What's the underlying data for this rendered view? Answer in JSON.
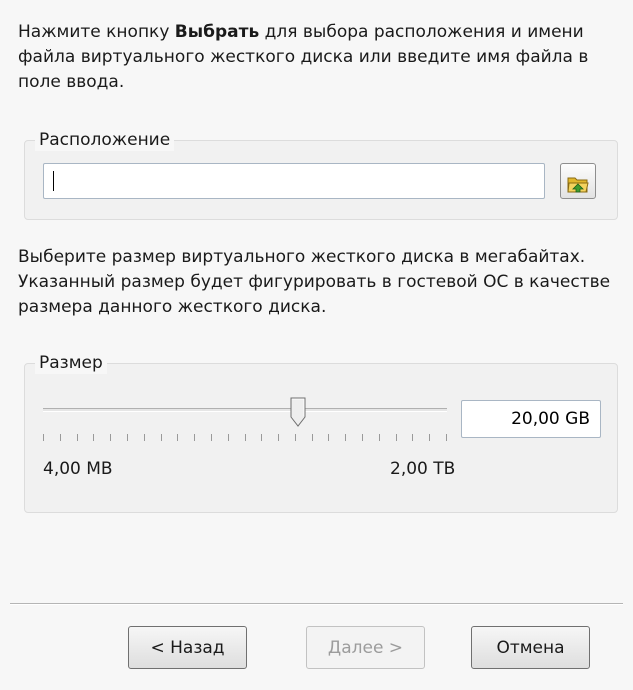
{
  "intro": {
    "text_before": "Нажмите кнопку ",
    "bold_word": "Выбрать",
    "text_after": " для выбора расположения и имени файла виртуального жесткого диска или введите имя файла в поле ввода."
  },
  "location": {
    "title": "Расположение",
    "value": "",
    "browse_icon": "folder-open-icon"
  },
  "size_description": "Выберите размер виртуального жесткого диска в мегабайтах. Указанный размер будет фигурировать в гостевой ОС в качестве размера данного жесткого диска.",
  "size": {
    "title": "Размер",
    "value": "20,00 GB",
    "min_label": "4,00 MB",
    "max_label": "2,00 TB",
    "slider_position": 0.63,
    "tick_count": 25
  },
  "buttons": {
    "back": "< Назад",
    "next": "Далее >",
    "cancel": "Отмена"
  },
  "colors": {
    "folder": "#e2b72c",
    "folder_arrow": "#3f9b2f"
  }
}
